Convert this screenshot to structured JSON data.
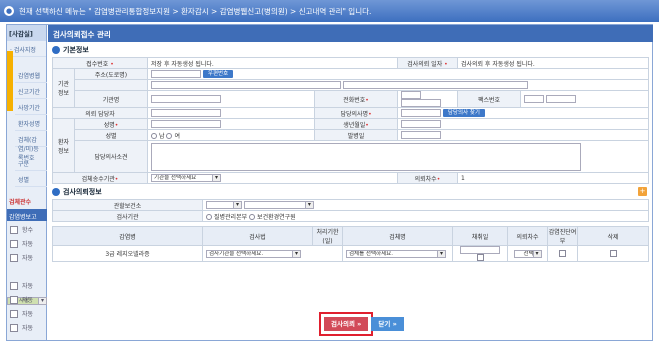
{
  "breadcrumb": "현재 선택하신 메뉴는 \" 감염병관리통합정보지원 > 환자감시 > 감염병웹신고(병의원) > 신고내역 관리\" 입니다.",
  "sidebar": {
    "head": "[사감실]",
    "sub_head": "· 검사지정",
    "strip_text": "메뉴",
    "items": [
      "감염병웹",
      "신고기간",
      "사망기간",
      "환자성명",
      "검체(감염/미)등록번호"
    ],
    "items2": [
      "구분",
      "성별"
    ],
    "section_label": "검체관수",
    "report_label": "감염병보고",
    "rows": [
      "항수",
      "자동",
      "자동",
      "자동",
      "자동",
      "자동",
      "자동",
      "자동",
      "자동"
    ]
  },
  "title": "검사의뢰접수 관리",
  "basic": {
    "section_title": "기본정보",
    "receipt_no_label": "접수번호",
    "receipt_no_value": "저장 후 자동생성 됩니다.",
    "request_date_label": "검사의뢰 일자",
    "request_date_value": "검사의뢰 후 자동생성 됩니다.",
    "org_info_label": "기관정보",
    "address_label": "주소(도로명)",
    "zip_button": "우편번호",
    "org_name_label": "기관명",
    "phone_label": "전화번호",
    "fax_label": "팩스번호",
    "requester_label": "의뢰 담당자",
    "doctor_label": "담당의사명",
    "find_doctor_button": "담당의사 찾기",
    "patient_info_label": "환자정보",
    "name_label": "성명",
    "birth_label": "생년월일",
    "sex_label": "성별",
    "male": "남",
    "female": "여",
    "onset_label": "발병일",
    "opinion_label": "담당의사소견",
    "sample_org_label": "검체송수기관",
    "sample_org_value": "기관을 선택하세요",
    "request_count_label": "의뢰차수",
    "request_count_value": "1"
  },
  "request": {
    "section_title": "검사의뢰정보",
    "health_center_label": "관할보건소",
    "lab_label": "검사기관",
    "lab_options": [
      "질병관리본부",
      "보건환경연구원"
    ],
    "columns": [
      "감염병",
      "검사법",
      "처리기한(일)",
      "검체명",
      "채취일",
      "의뢰차수",
      "감염진단여부",
      "삭제"
    ],
    "row": {
      "disease": "3급 레지오넬라증",
      "method": "검사기관을 선택하세요.",
      "sample": "검체를 선택하세요.",
      "count": "선택"
    }
  },
  "buttons": {
    "request": "검사의뢰 »",
    "close": "닫기 »"
  }
}
